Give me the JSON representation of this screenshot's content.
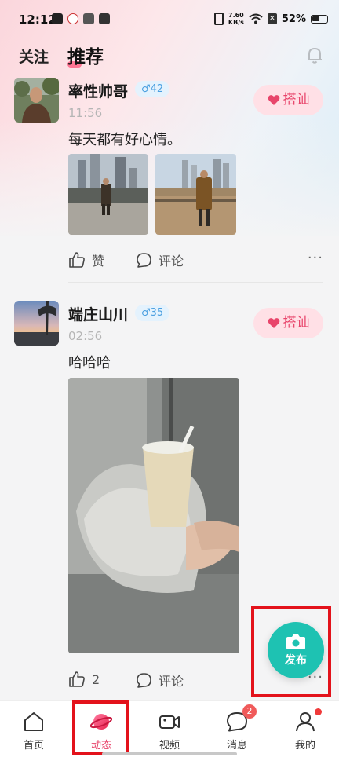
{
  "status_bar": {
    "time": "12:12",
    "net_speed_value": "7.60",
    "net_speed_unit": "KB/s",
    "battery": "52%"
  },
  "header": {
    "tab_follow": "关注",
    "tab_recommend": "推荐",
    "bell_icon": "bell-icon"
  },
  "posts": [
    {
      "username": "率性帅哥",
      "gender_age": "♂42",
      "time": "11:56",
      "text": "每天都有好心情。",
      "greet_label": "搭讪",
      "like_label": "赞",
      "comment_label": "评论",
      "more": "···"
    },
    {
      "username": "端庄山川",
      "gender_age": "♂35",
      "time": "02:56",
      "text": "哈哈哈",
      "greet_label": "搭讪",
      "like_label": "2",
      "comment_label": "评论",
      "more": "···"
    }
  ],
  "fab": {
    "label": "发布",
    "icon": "camera-icon"
  },
  "bottom_nav": [
    {
      "label": "首页",
      "icon": "home-icon"
    },
    {
      "label": "动态",
      "icon": "planet-icon",
      "active": true
    },
    {
      "label": "视频",
      "icon": "video-icon"
    },
    {
      "label": "消息",
      "icon": "chat-icon",
      "badge": "2"
    },
    {
      "label": "我的",
      "icon": "person-icon"
    }
  ],
  "colors": {
    "accent_pink": "#e8456b",
    "badge_blue": "#4a9fe0",
    "fab_teal": "#1ec2b2",
    "highlight_red": "#e3121b"
  }
}
